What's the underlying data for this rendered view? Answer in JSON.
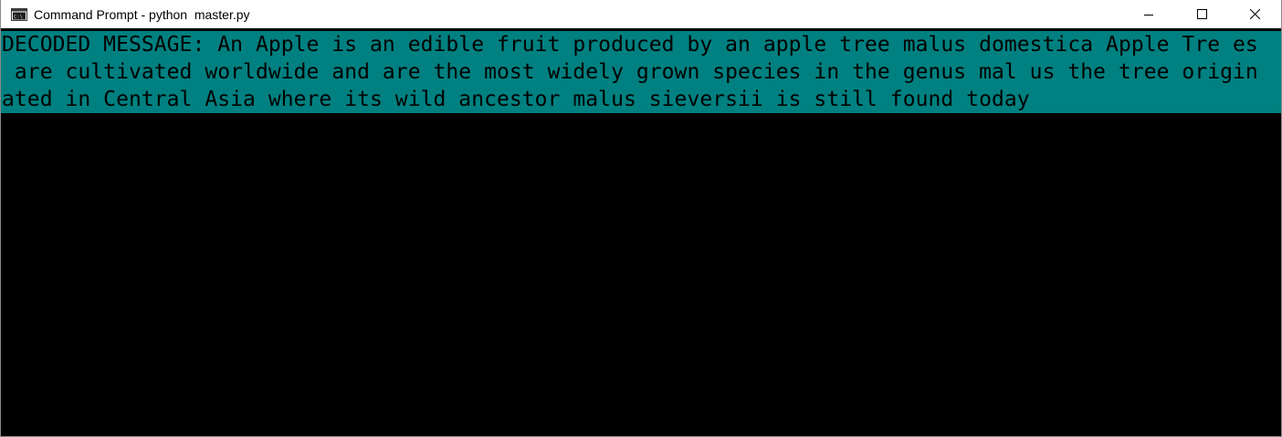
{
  "window": {
    "title": "Command Prompt - python  master.py",
    "icon": "console-icon"
  },
  "controls": {
    "minimize_icon": "minimize-icon",
    "maximize_icon": "maximize-icon",
    "close_icon": "close-icon"
  },
  "console": {
    "lines": [
      "DECODED MESSAGE: An Apple is an edible fruit produced by an apple tree malus domestica Apple Tre es",
      " are cultivated worldwide and are the most widely grown species in the genus mal us the tree origin",
      "ated in Central Asia where its wild ancestor malus sieversii is still found today"
    ],
    "text_color": "#000000",
    "highlight_color": "#008080",
    "background_color": "#000000"
  }
}
